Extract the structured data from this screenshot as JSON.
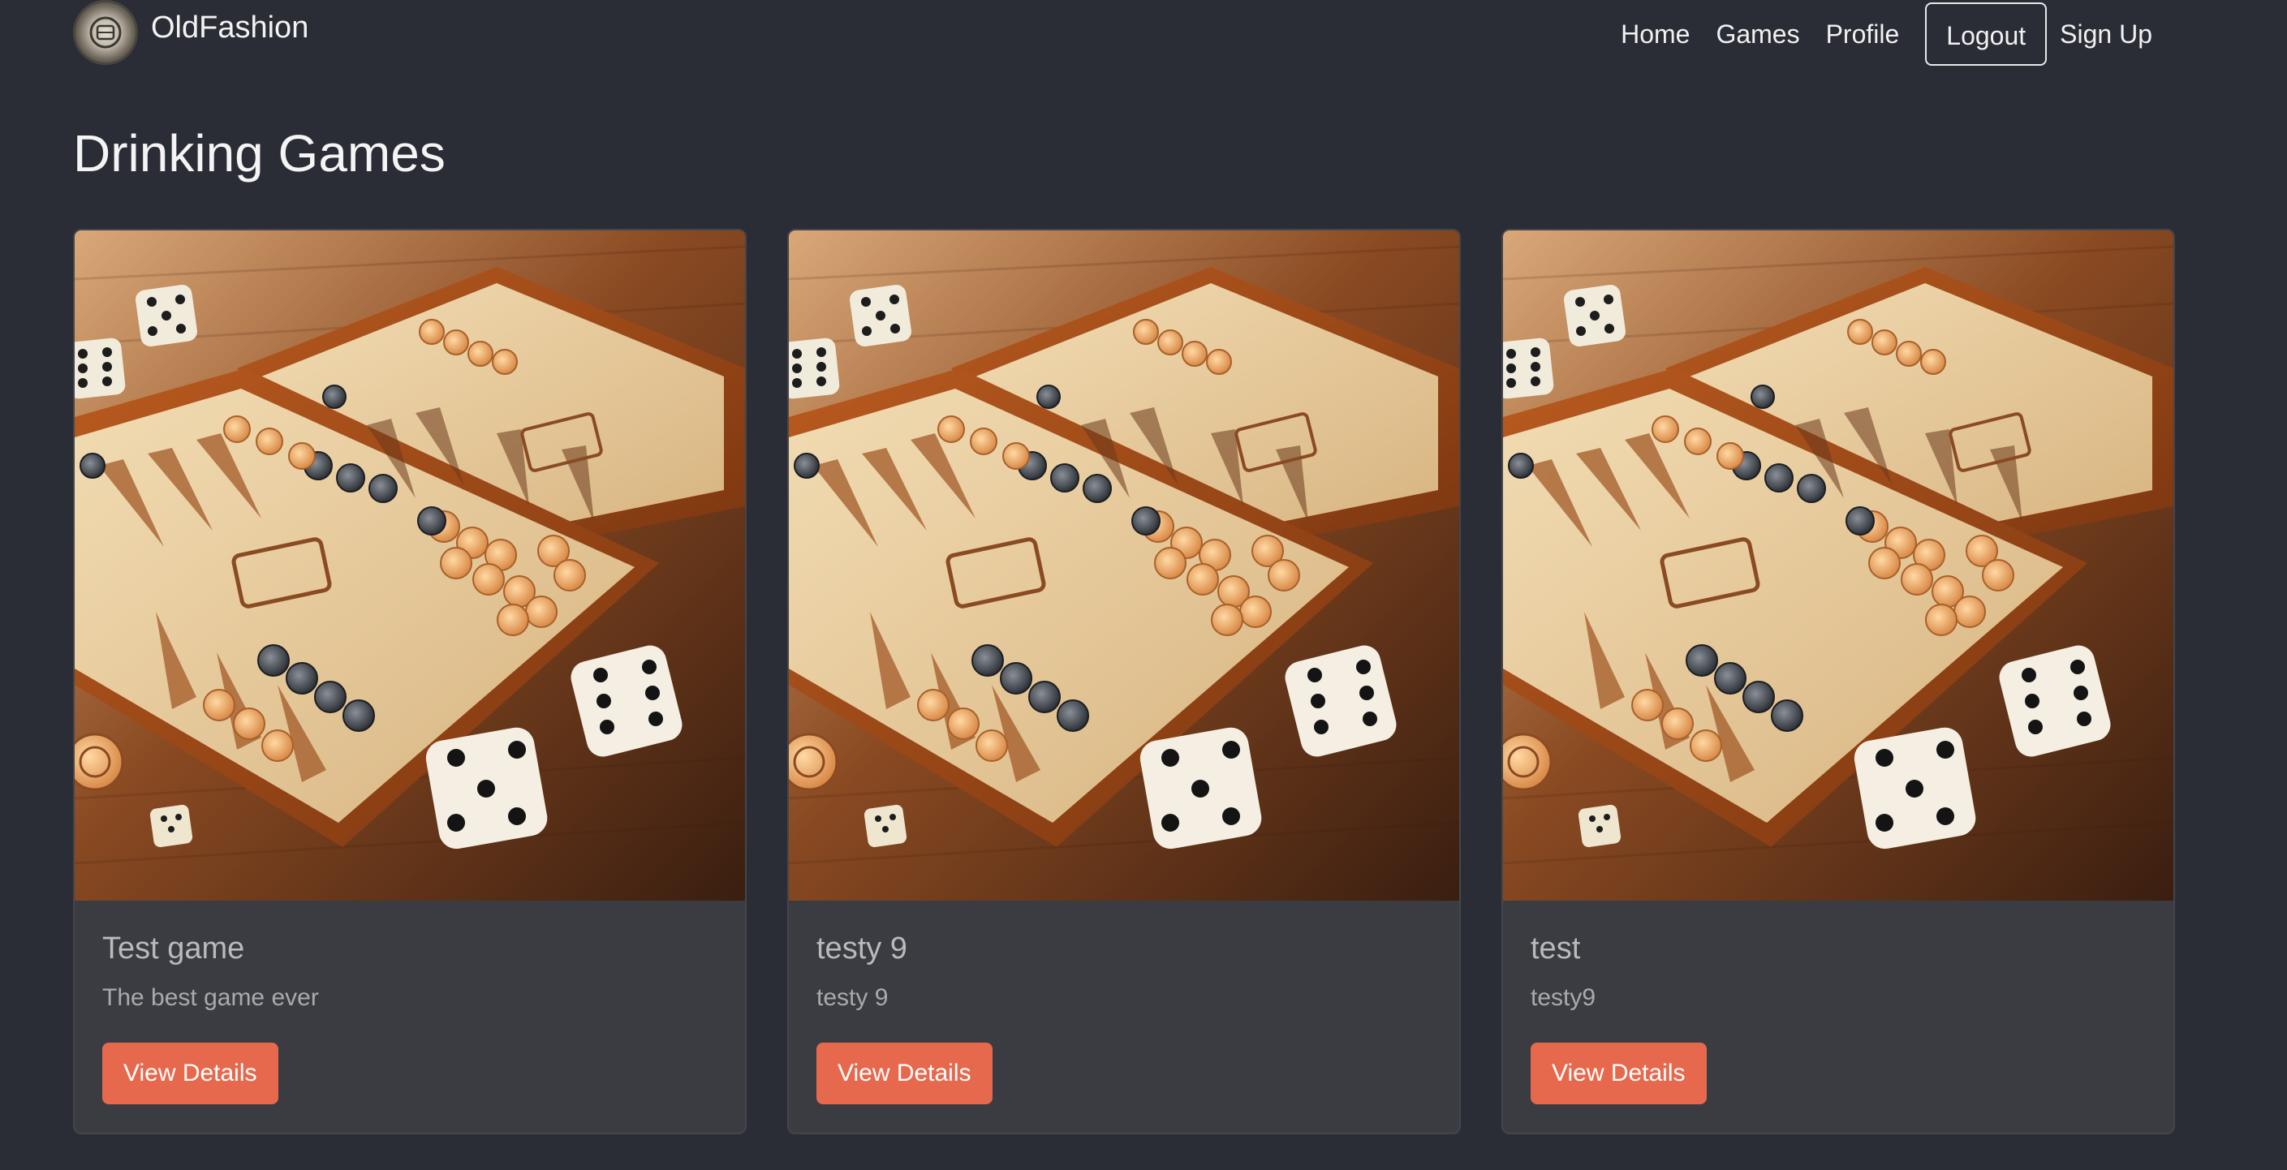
{
  "brand": {
    "name": "OldFashion"
  },
  "nav": {
    "items": [
      {
        "label": "Home"
      },
      {
        "label": "Games"
      },
      {
        "label": "Profile"
      },
      {
        "label": "Logout"
      },
      {
        "label": "Sign Up"
      }
    ]
  },
  "page": {
    "title": "Drinking Games"
  },
  "cards": [
    {
      "title": "Test game",
      "description": "The best game ever",
      "button": "View Details"
    },
    {
      "title": "testy 9",
      "description": "testy 9",
      "button": "View Details"
    },
    {
      "title": "test",
      "description": "testy9",
      "button": "View Details"
    }
  ],
  "colors": {
    "background": "#2a2d35",
    "card": "#3a3c42",
    "accent": "#e7694d"
  }
}
